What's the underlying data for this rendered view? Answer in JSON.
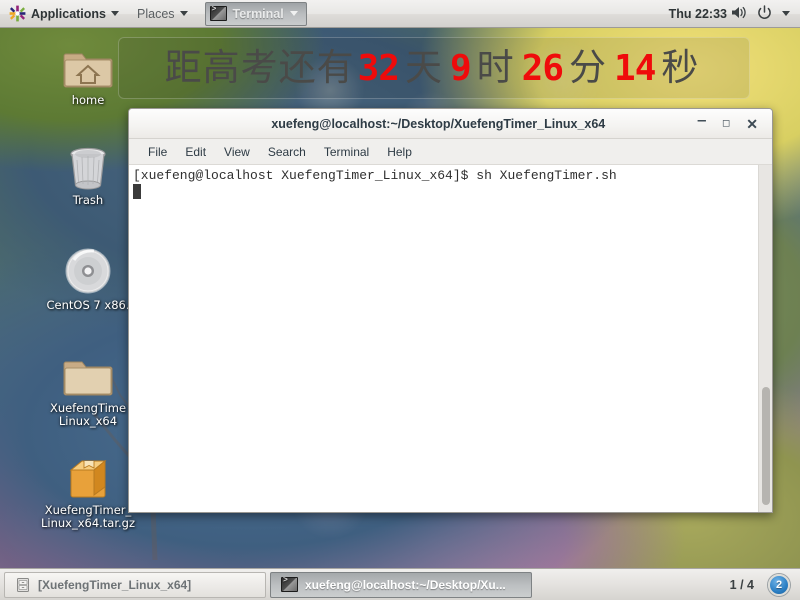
{
  "top_panel": {
    "applications_label": "Applications",
    "places_label": "Places",
    "window_list_item": "Terminal",
    "clock": "Thu 22:33",
    "icons": {
      "menu_logo": "centos-logo-icon",
      "volume": "volume-icon",
      "power": "power-icon",
      "dropdown": "chevron-down-icon"
    }
  },
  "countdown": {
    "prefix": "距高考还有",
    "days": "32",
    "days_unit": "天",
    "hours": "9",
    "hours_unit": "时",
    "minutes": "26",
    "minutes_unit": "分",
    "seconds": "14",
    "seconds_unit": "秒",
    "number_color": "#ef0b0b",
    "text_color": "#4a4a48"
  },
  "desktop_icons": [
    {
      "name": "home",
      "label": "home",
      "icon": "home-folder-icon"
    },
    {
      "name": "trash",
      "label": "Trash",
      "icon": "trash-icon"
    },
    {
      "name": "centos-disc",
      "label": "CentOS 7 x86.",
      "icon": "optical-disc-icon"
    },
    {
      "name": "xuefengtimer-folder",
      "label": "XuefengTime\nLinux_x64",
      "icon": "folder-icon"
    },
    {
      "name": "xuefengtimer-archive",
      "label": "XuefengTimer_\nLinux_x64.tar.gz",
      "icon": "archive-icon"
    }
  ],
  "terminal": {
    "title": "xuefeng@localhost:~/Desktop/XuefengTimer_Linux_x64",
    "window_buttons": {
      "minimize": "–",
      "maximize": "❐",
      "close": "✕"
    },
    "menu": [
      "File",
      "Edit",
      "View",
      "Search",
      "Terminal",
      "Help"
    ],
    "prompt": "[xuefeng@localhost XuefengTimer_Linux_x64]$ ",
    "command": "sh XuefengTimer.sh",
    "background": "#ffffff",
    "foreground": "#2f2f2f"
  },
  "bottom_panel": {
    "tasks": [
      {
        "label": "[XuefengTimer_Linux_x64]",
        "icon": "file-manager-icon",
        "active": false
      },
      {
        "label": "xuefeng@localhost:~/Desktop/Xu...",
        "icon": "terminal-icon",
        "active": true
      }
    ],
    "workspace": "1 / 4",
    "notification_count": "2"
  }
}
